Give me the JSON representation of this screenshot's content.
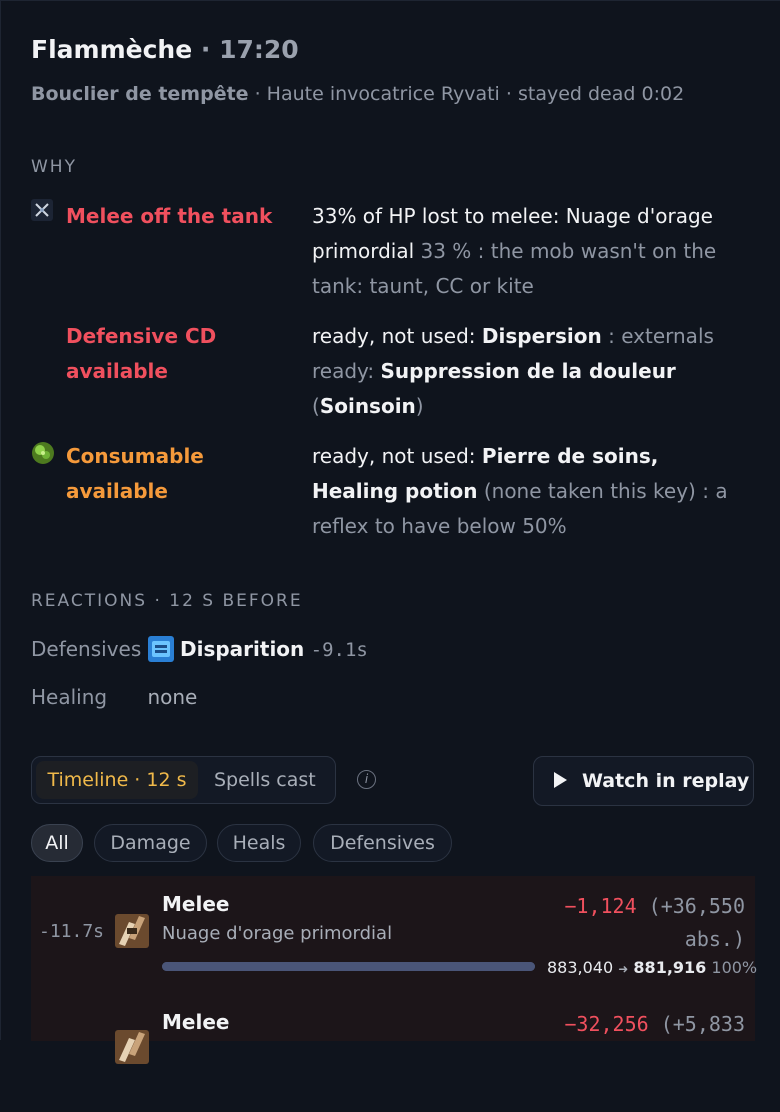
{
  "header": {
    "player": "Flammèche",
    "separator": " · ",
    "time": "17:20",
    "ability": "Bouclier de tempête",
    "boss": "Haute invocatrice Ryvati",
    "status": "stayed dead 0:02"
  },
  "why": {
    "label": "WHY",
    "items": [
      {
        "icon": "melee-swords-icon",
        "title": "Melee off the tank",
        "color": "#f0505e",
        "text_strong": "33% of HP lost to melee: Nuage d'orage primordial",
        "text_rest": " 33 % : the mob wasn't on the tank: taunt, CC or kite"
      },
      {
        "icon": "",
        "title": "Defensive CD available",
        "color": "#f0505e",
        "text_lead": "ready, not used: ",
        "text_spell": "Dispersion",
        "text_mid": " : externals ready: ",
        "text_external": "Suppression de la douleur",
        "text_paren_open": " (",
        "text_healer": "Soinsoin",
        "text_paren_close": ")"
      },
      {
        "icon": "healthstone-icon",
        "title": "Consumable available",
        "color": "#f59a3b",
        "text_lead": "ready, not used: ",
        "text_item1": "Pierre de soins,",
        "text_item2": "Healing potion",
        "text_rest": " (none taken this key) : a reflex to have below 50%"
      }
    ]
  },
  "reactions": {
    "label": "REACTIONS · 12 S BEFORE",
    "defensives_label": "Defensives",
    "defensive_spell": "Disparition",
    "defensive_time": "-9.1s",
    "healing_label": "Healing",
    "healing_value": "none"
  },
  "tabs": {
    "timeline": "Timeline · 12 s",
    "spells": "Spells cast",
    "info": "i",
    "replay": "Watch in replay"
  },
  "filters": [
    "All",
    "Damage",
    "Heals",
    "Defensives"
  ],
  "events": [
    {
      "time": "-11.7s",
      "name": "Melee",
      "source": "Nuage d'orage primordial",
      "damage": "−1,124",
      "absorbed": "(+36,550 abs.)",
      "hp_before": "883,040",
      "hp_after": "881,916",
      "hp_pct": "100%",
      "hp_fraction": 1.0
    },
    {
      "time": "",
      "name": "Melee",
      "source": "",
      "damage": "−32,256",
      "absorbed": "(+5,833"
    }
  ]
}
